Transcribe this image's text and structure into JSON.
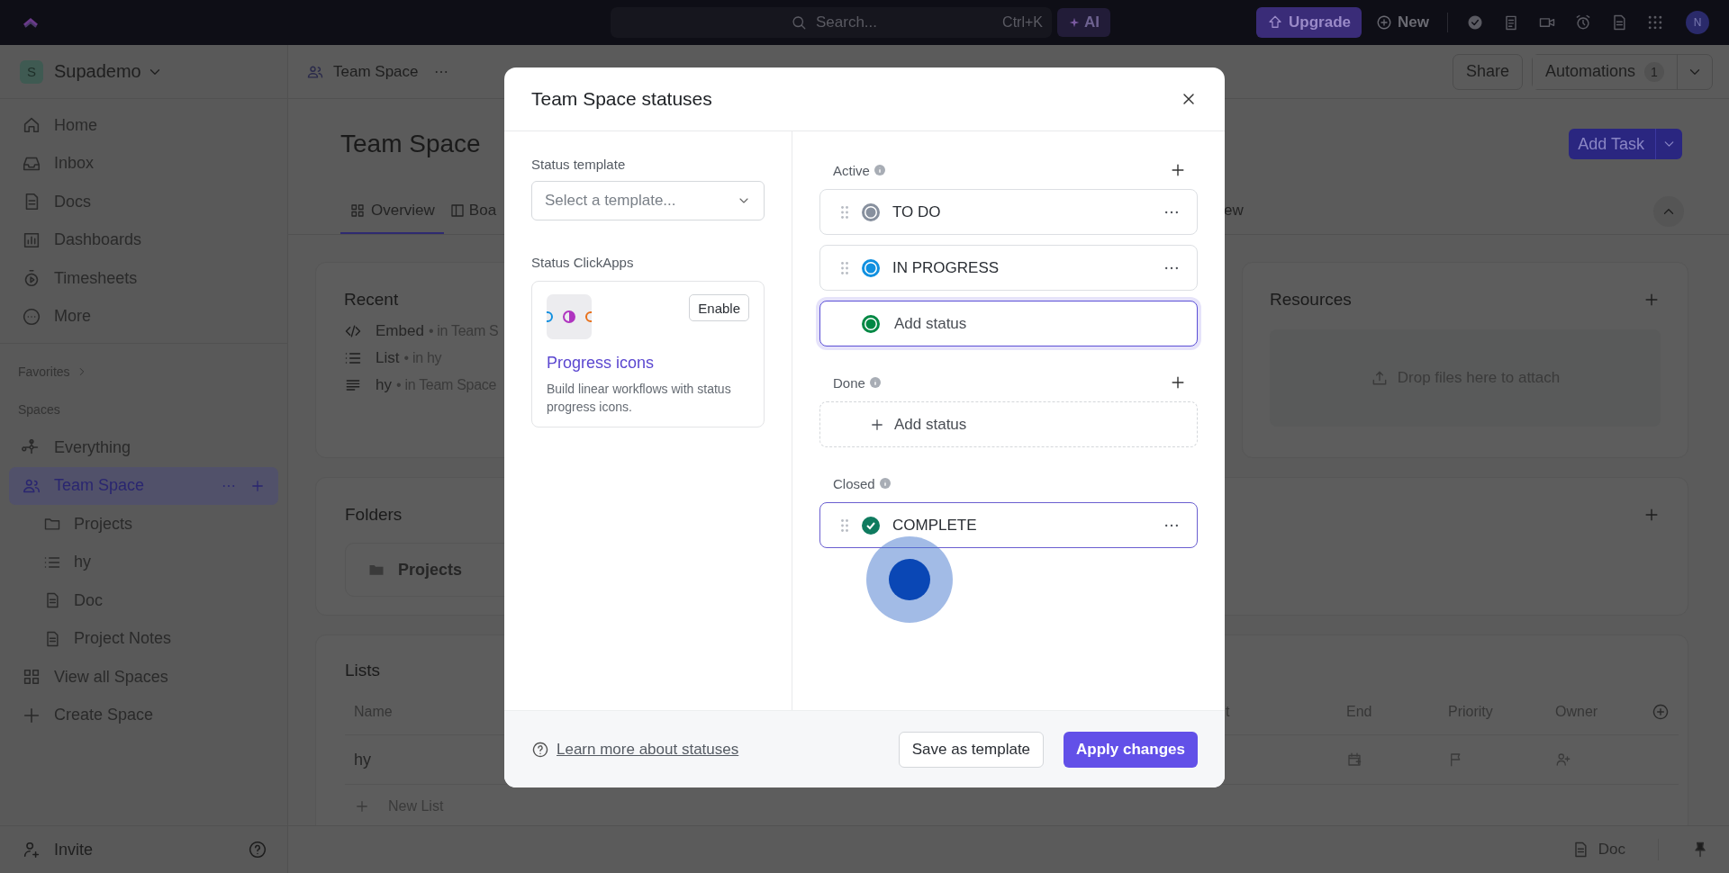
{
  "topbar": {
    "search": {
      "placeholder": "Search...",
      "shortcut": "Ctrl+K"
    },
    "ai_button": "AI",
    "upgrade_button": "Upgrade",
    "new_button": "New",
    "avatar": "N"
  },
  "sidebar": {
    "workspace": {
      "initial": "S",
      "name": "Supademo"
    },
    "nav": [
      {
        "label": "Home",
        "selected": false
      },
      {
        "label": "Inbox",
        "selected": false
      },
      {
        "label": "Docs",
        "selected": false
      },
      {
        "label": "Dashboards",
        "selected": false
      },
      {
        "label": "Timesheets",
        "selected": false
      },
      {
        "label": "More",
        "selected": false
      }
    ],
    "favorites": "Favorites",
    "spaces_heading": "Spaces",
    "spaces": [
      {
        "label": "Everything",
        "selected": false
      },
      {
        "label": "Team Space",
        "selected": true,
        "children": [
          {
            "label": "Projects",
            "selected": false
          },
          {
            "label": "hy",
            "selected": false
          },
          {
            "label": "Doc",
            "selected": false
          },
          {
            "label": "Project Notes",
            "selected": false
          }
        ]
      },
      {
        "label": "View all Spaces",
        "selected": false
      },
      {
        "label": "Create Space",
        "selected": false
      }
    ],
    "invite": "Invite"
  },
  "header": {
    "breadcrumb": "Team Space",
    "share_button": "Share",
    "automations_button": "Automations",
    "automations_count": "1"
  },
  "page": {
    "title": "Team Space",
    "add_task_button": "Add Task",
    "tabs": [
      {
        "label": "Overview",
        "selected": true
      },
      {
        "label": "Boa",
        "selected": false
      },
      {
        "label": "ew",
        "selected": false
      }
    ],
    "recent": {
      "title": "Recent",
      "items": [
        {
          "name": "Embed",
          "meta": "• in Team S"
        },
        {
          "name": "List",
          "meta": "• in hy"
        },
        {
          "name": "hy",
          "meta": "• in Team Space"
        }
      ]
    },
    "resources": {
      "title": "Resources",
      "dropzone": "Drop files here to attach"
    },
    "folders": {
      "title": "Folders",
      "items": [
        "Projects"
      ]
    },
    "lists": {
      "title": "Lists",
      "columns": [
        "Name",
        "t",
        "End",
        "Priority",
        "Owner"
      ],
      "rows": [
        {
          "name": "hy"
        }
      ],
      "new_list": "New List"
    }
  },
  "modal": {
    "title": "Team Space statuses",
    "template": {
      "label": "Status template",
      "placeholder": "Select a template..."
    },
    "clickapps": {
      "label": "Status ClickApps",
      "title": "Progress icons",
      "description": "Build linear workflows with status progress icons.",
      "button": "Enable"
    },
    "groups": [
      {
        "name": "Active",
        "kind": "active",
        "items": [
          {
            "kind": "status",
            "name": "TO DO",
            "color": "#87909e",
            "highlighted": false
          },
          {
            "kind": "status",
            "name": "IN PROGRESS",
            "color": "#1090e0",
            "highlighted": false
          },
          {
            "kind": "new",
            "placeholder": "Add status",
            "color": "#008844"
          }
        ]
      },
      {
        "name": "Done",
        "kind": "done",
        "items": [
          {
            "kind": "add",
            "label": "Add status"
          }
        ]
      },
      {
        "name": "Closed",
        "kind": "closed",
        "items": [
          {
            "kind": "status",
            "name": "COMPLETE",
            "color": "#0f7b5f",
            "highlighted": true
          }
        ]
      }
    ],
    "learn_more": "Learn more about statuses",
    "save_button": "Save as template",
    "apply_button": "Apply changes"
  },
  "bottom_bar": {
    "doc": "Doc"
  },
  "click_indicator": true
}
